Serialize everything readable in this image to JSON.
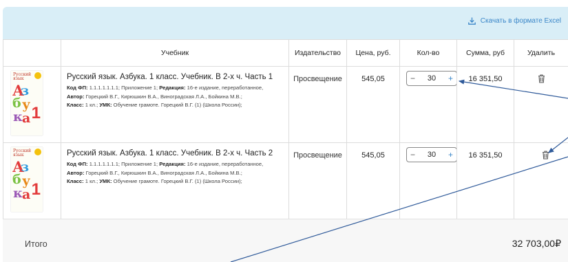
{
  "toolbar": {
    "excel_label": "Скачать в формате Excel"
  },
  "table": {
    "headers": [
      "",
      "Учебник",
      "Издательство",
      "Цена, руб.",
      "Кол-во",
      "Сумма, руб",
      "Удалить"
    ]
  },
  "rows": [
    {
      "title": "Русский язык. Азбука. 1 класс. Учебник. В 2-х ч. Часть 1",
      "line1_fp_label": "Код ФП:",
      "line1_fp_value": "1.1.1.1.1.1.1; Приложение 1;",
      "line1_ed_label": "Редакция:",
      "line1_ed_value": "16-е издание, переработанное,",
      "line2_author_label": "Автор:",
      "line2_author_value": "Горецкий В.Г., Кирюшкин В.А., Виноградская Л.А., Бойкина М.В.;",
      "line3_class_label": "Класс:",
      "line3_class_value": "1 кл.;",
      "line3_umk_label": "УМК:",
      "line3_umk_value": "Обучение грамоте. Горецкий В.Г. (1) (Школа России);",
      "publisher": "Просвещение",
      "price": "545,05",
      "qty_minus": "−",
      "qty": "30",
      "qty_plus": "+",
      "sum": "16 351,50",
      "cover_title": "Русский язык",
      "cover_letters": [
        "А",
        "з",
        "б",
        "у",
        "к",
        "а"
      ],
      "cover_num": "1"
    },
    {
      "title": "Русский язык. Азбука. 1 класс. Учебник. В 2-х ч. Часть 2",
      "line1_fp_label": "Код ФП:",
      "line1_fp_value": "1.1.1.1.1.1.1; Приложение 1;",
      "line1_ed_label": "Редакция:",
      "line1_ed_value": "16-е издание, переработанное,",
      "line2_author_label": "Автор:",
      "line2_author_value": "Горецкий В.Г., Кирюшкин В.А., Виноградская Л.А., Бойкина М.В.;",
      "line3_class_label": "Класс:",
      "line3_class_value": "1 кл.;",
      "line3_umk_label": "УМК:",
      "line3_umk_value": "Обучение грамоте. Горецкий В.Г. (1) (Школа России);",
      "publisher": "Просвещение",
      "price": "545,05",
      "qty_minus": "−",
      "qty": "30",
      "qty_plus": "+",
      "sum": "16 351,50",
      "cover_title": "Русский язык",
      "cover_letters": [
        "А",
        "з",
        "б",
        "у",
        "к",
        "а"
      ],
      "cover_num": "1"
    }
  ],
  "total": {
    "label": "Итого",
    "value": "32 703,00₽"
  },
  "icons": {
    "download": "download-icon",
    "delete": "trash-icon"
  },
  "colors": {
    "accent": "#3a86c8",
    "topbar": "#d9eef7",
    "annotation": "#2f5a9a"
  }
}
